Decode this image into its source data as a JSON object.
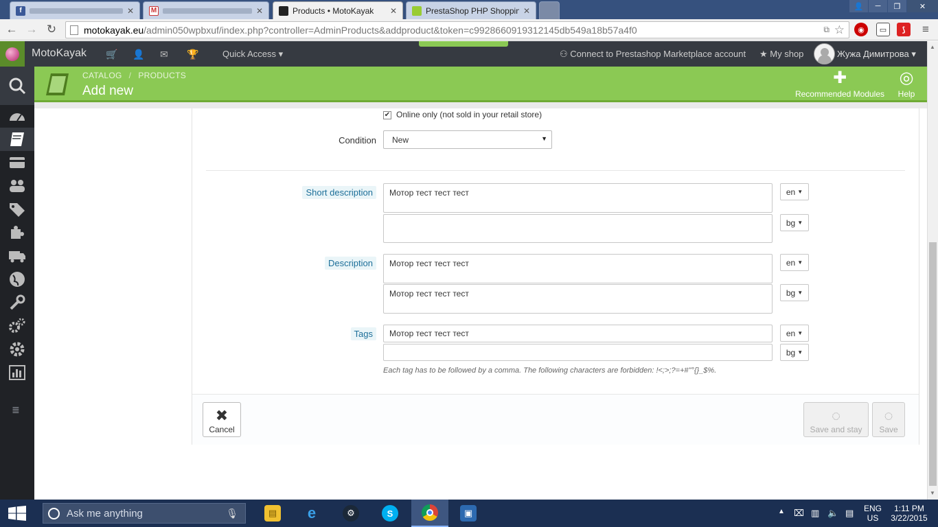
{
  "browser": {
    "tabs": [
      {
        "title": "",
        "favicon": "facebook-icon",
        "active": false
      },
      {
        "title": "",
        "favicon": "gmail-icon",
        "active": false
      },
      {
        "title": "Products • MotoKayak",
        "favicon": "prestashop-icon",
        "active": true
      },
      {
        "title": "PrestaShop PHP Shopping",
        "favicon": "prestashop-green-icon",
        "active": false
      }
    ],
    "url_host": "motokayak.eu",
    "url_path": "/admin050wpbxuf/index.php?controller=AdminProducts&addproduct&token=c9928660919312145db549a18b57a4f0"
  },
  "header": {
    "shop_name": "MotoKayak",
    "quick_access": "Quick Access ▾",
    "connect": "Connect to Prestashop Marketplace account",
    "my_shop": "My shop",
    "user_name": "Жужа Димитрова ▾"
  },
  "sidebar": {
    "items": [
      "search-icon",
      "dashboard-icon",
      "catalog-icon",
      "orders-icon",
      "customers-icon",
      "price-rules-icon",
      "modules-icon",
      "shipping-icon",
      "localization-icon",
      "preferences-icon",
      "advanced-params-icon",
      "administration-icon",
      "stats-icon"
    ],
    "active": "catalog-icon"
  },
  "page": {
    "breadcrumb_1": "CATALOG",
    "breadcrumb_2": "PRODUCTS",
    "title": "Add new",
    "recommended_modules": "Recommended Modules",
    "help": "Help"
  },
  "form": {
    "online_only_label": "Online only (not sold in your retail store)",
    "online_only_checked": true,
    "condition_label": "Condition",
    "condition_value": "New",
    "short_description_label": "Short description",
    "short_description_en": "Мотор тест тест тест",
    "short_description_bg": "",
    "description_label": "Description",
    "description_en": "Мотор тест тест тест",
    "description_bg": "Мотор тест тест тест",
    "tags_label": "Tags",
    "tags_en": "Мотор тест тест тест",
    "tags_bg": "",
    "lang_en": "en",
    "lang_bg": "bg",
    "tags_help": "Each tag has to be followed by a comma. The following characters are forbidden: !<;>;?=+#\"°{}_$%."
  },
  "footer": {
    "cancel": "Cancel",
    "save_and_stay": "Save and stay",
    "save": "Save"
  },
  "taskbar": {
    "search_placeholder": "Ask me anything",
    "lang_top": "ENG",
    "lang_bottom": "US",
    "time": "1:11 PM",
    "date": "3/22/2015"
  },
  "colors": {
    "accent_green": "#8bc954",
    "header_dark": "#363a41",
    "sidebar_dark": "#202226",
    "taskbar": "#1b2f52"
  }
}
